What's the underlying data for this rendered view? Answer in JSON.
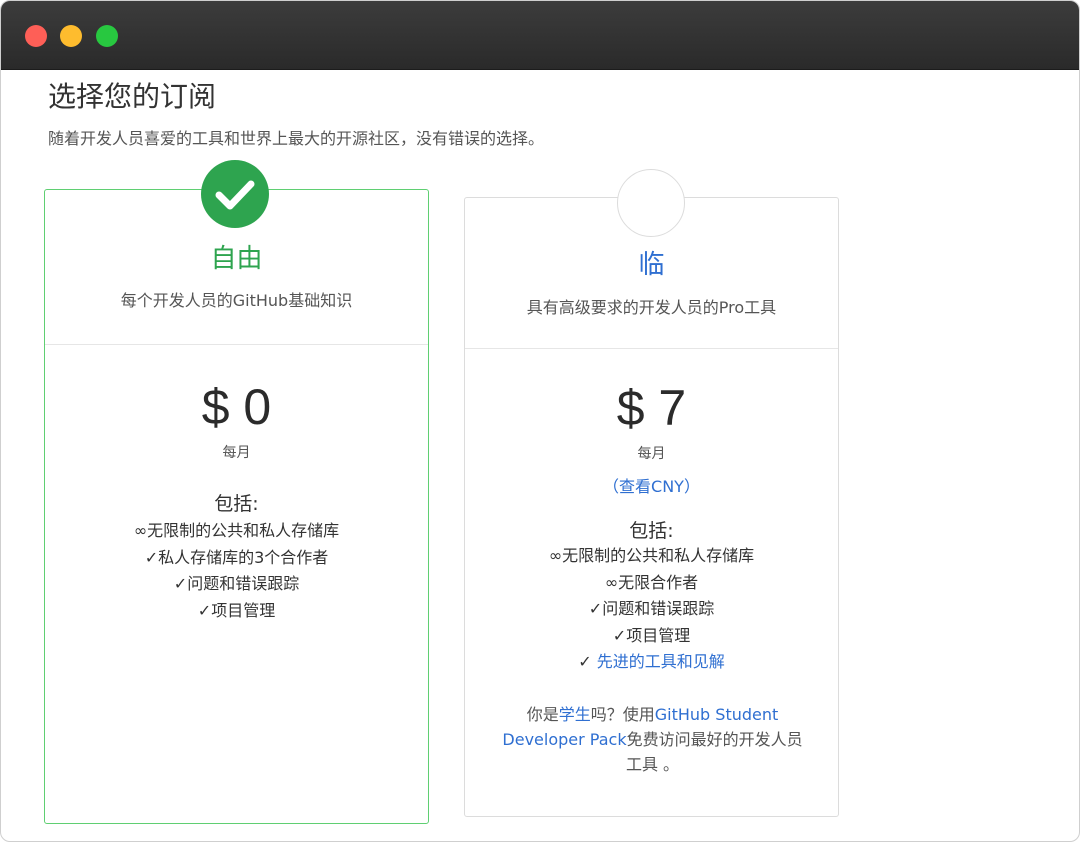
{
  "page": {
    "title": "选择您的订阅",
    "subtitle": "随着开发人员喜爱的工具和世界上最大的开源社区，没有错误的选择。"
  },
  "colors": {
    "accent_green": "#2ea44f",
    "link_blue": "#2f6fd1",
    "selected_border": "#5fcf72"
  },
  "plans": [
    {
      "name": "自由",
      "description": "每个开发人员的GitHub基础知识",
      "price": "$ 0",
      "period": "每月",
      "includes_label": "包括:",
      "selected": true,
      "badge_icon": "checkmark-icon",
      "features": [
        "∞无限制的公共和私人存储库",
        "✓私人存储库的3个合作者",
        "✓问题和错误跟踪",
        "✓项目管理"
      ]
    },
    {
      "name": "临",
      "description": "具有高级要求的开发人员的Pro工具",
      "price": "$ 7",
      "period": "每月",
      "currency_link": "（查看CNY）",
      "includes_label": "包括:",
      "selected": false,
      "features": [
        "∞无限制的公共和私人存储库",
        "∞无限合作者",
        "✓问题和错误跟踪",
        "✓项目管理"
      ],
      "advanced_feature_mark": "✓ ",
      "advanced_feature_link": "先进的工具和见解",
      "student_note": {
        "pre": "你是",
        "student_link": "学生",
        "mid": "吗？使用",
        "pack_link": "GitHub Student Developer Pack",
        "post": "免费访问最好的开发人员工具 。"
      }
    }
  ]
}
